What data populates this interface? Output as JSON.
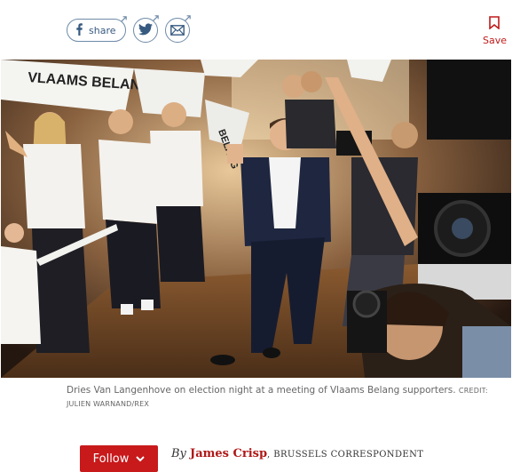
{
  "share": {
    "facebook_label": "share"
  },
  "save": {
    "label": "Save"
  },
  "photo": {
    "flag_text_left": "VLAAMS BELANG",
    "flag_text_right": "BELANG"
  },
  "caption": {
    "text": "Dries Van Langenhove on election night at a meeting of Vlaams Belang supporters.",
    "credit": "CREDIT: JULIEN WARNAND/REX"
  },
  "follow": {
    "label": "Follow"
  },
  "byline": {
    "prefix": "By",
    "author": "James Crisp",
    "role": "BRUSSELS CORRESPONDENT"
  },
  "colors": {
    "accent_red": "#c8191b",
    "share_blue": "#375a80"
  }
}
